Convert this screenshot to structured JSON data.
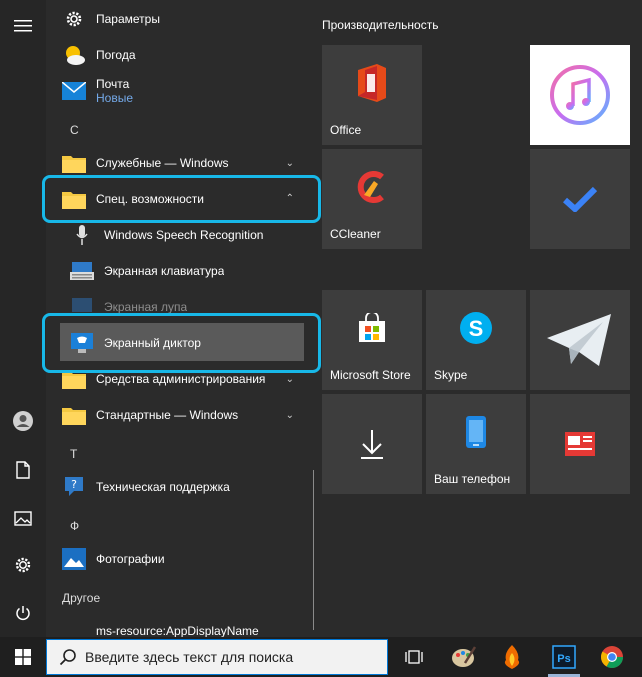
{
  "app_list": {
    "settings": "Параметры",
    "weather": "Погода",
    "mail": "Почта",
    "mail_sub": "Новые",
    "letter_c": "С",
    "system_tools": "Служебные — Windows",
    "accessibility": "Спец. возможности",
    "speech": "Windows Speech Recognition",
    "osk": "Экранная клавиатура",
    "magnifier": "Экранная лупа",
    "narrator": "Экранный диктор",
    "admin_tools": "Средства администрирования W...",
    "accessories": "Стандартные — Windows",
    "letter_t": "Т",
    "support": "Техническая поддержка",
    "letter_f": "Ф",
    "photos": "Фотографии",
    "other_header": "Другое",
    "ms_resource": "ms-resource:AppDisplayName"
  },
  "tiles": {
    "group_title": "Производительность",
    "office": "Office",
    "ccleaner": "CCleaner",
    "ms_store": "Microsoft Store",
    "skype": "Skype",
    "your_phone": "Ваш телефон"
  },
  "taskbar": {
    "search_placeholder": "Введите здесь текст для поиска"
  },
  "colors": {
    "highlight": "#18b8e8",
    "accent": "#0078d7"
  }
}
